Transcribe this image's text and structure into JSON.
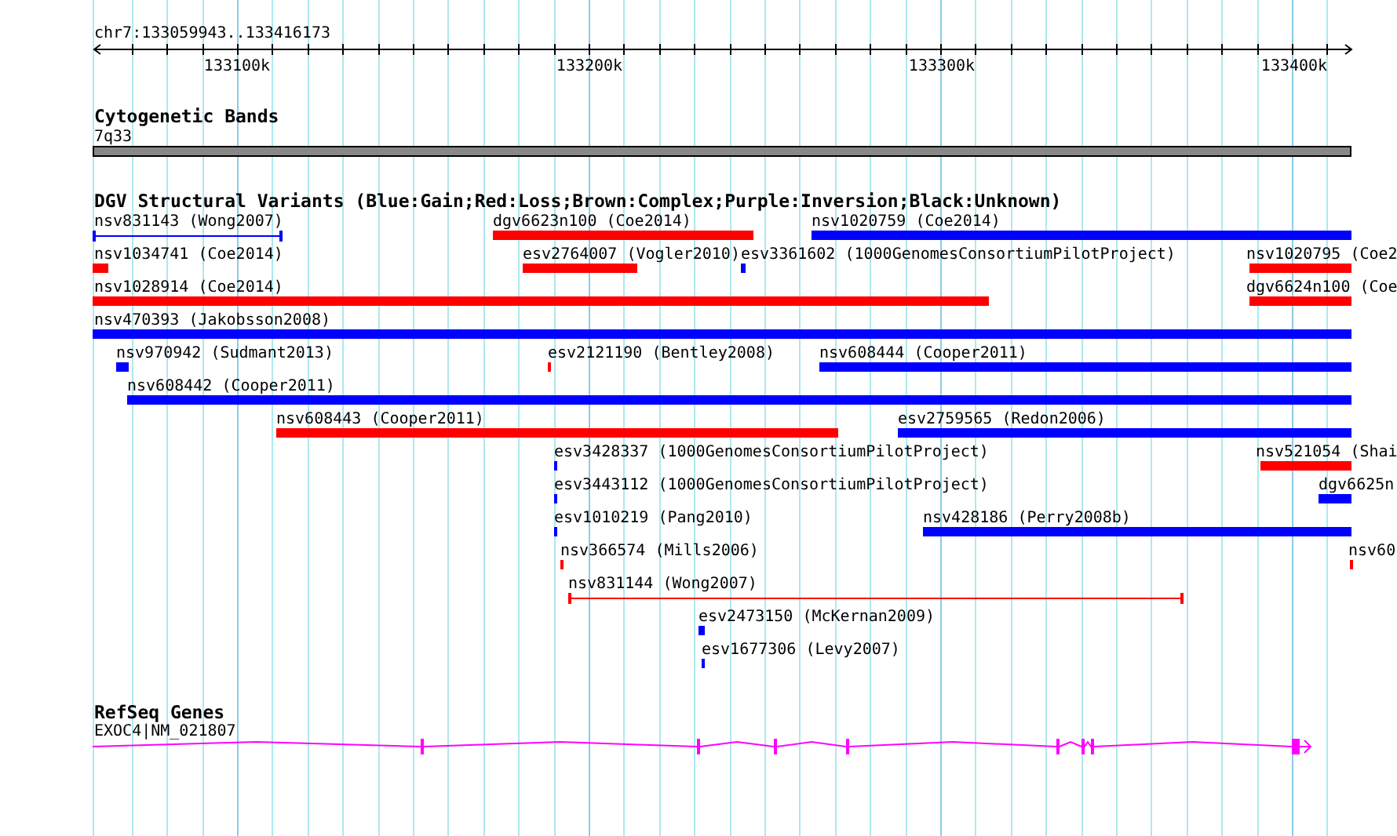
{
  "ruler": {
    "position": "chr7:133059943..133416173",
    "ticks": [
      "133100k",
      "133200k",
      "133300k",
      "133400k"
    ]
  },
  "cytogenetic_bands": {
    "title": "Cytogenetic Bands",
    "band_label": "7q33"
  },
  "dgv_variants": {
    "title": "DGV Structural Variants (Blue:Gain;Red:Loss;Brown:Complex;Purple:Inversion;Black:Unknown)",
    "rows": [
      {
        "features": [
          {
            "label": "nsv831143 (Wong2007)",
            "color": "#0000ff",
            "kind": "line"
          },
          {
            "label": "dgv6623n100 (Coe2014)",
            "color": "#ff0000",
            "kind": "bar"
          },
          {
            "label": "nsv1020759 (Coe2014)",
            "color": "#0000ff",
            "kind": "bar"
          }
        ]
      },
      {
        "features": [
          {
            "label": "nsv1034741 (Coe2014)",
            "color": "#ff0000",
            "kind": "bar"
          },
          {
            "label": "esv2764007 (Vogler2010)",
            "color": "#ff0000",
            "kind": "bar"
          },
          {
            "label": "esv3361602 (1000GenomesConsortiumPilotProject)",
            "color": "#0000ff",
            "kind": "bar"
          },
          {
            "label": "nsv1020795 (Coe2",
            "color": "#ff0000",
            "kind": "bar"
          }
        ]
      },
      {
        "features": [
          {
            "label": "nsv1028914 (Coe2014)",
            "color": "#ff0000",
            "kind": "bar"
          },
          {
            "label": "dgv6624n100 (Coe",
            "color": "#ff0000",
            "kind": "bar"
          }
        ]
      },
      {
        "features": [
          {
            "label": "nsv470393 (Jakobsson2008)",
            "color": "#0000ff",
            "kind": "bar"
          }
        ]
      },
      {
        "features": [
          {
            "label": "nsv970942 (Sudmant2013)",
            "color": "#0000ff",
            "kind": "bar"
          },
          {
            "label": "esv2121190 (Bentley2008)",
            "color": "#ff0000",
            "kind": "bar"
          },
          {
            "label": "nsv608444 (Cooper2011)",
            "color": "#0000ff",
            "kind": "bar"
          }
        ]
      },
      {
        "features": [
          {
            "label": "nsv608442 (Cooper2011)",
            "color": "#0000ff",
            "kind": "bar"
          }
        ]
      },
      {
        "features": [
          {
            "label": "nsv608443 (Cooper2011)",
            "color": "#ff0000",
            "kind": "bar"
          },
          {
            "label": "esv2759565 (Redon2006)",
            "color": "#0000ff",
            "kind": "bar"
          }
        ]
      },
      {
        "features": [
          {
            "label": "esv3428337 (1000GenomesConsortiumPilotProject)",
            "color": "#0000ff",
            "kind": "bar"
          },
          {
            "label": "nsv521054 (Shai",
            "color": "#ff0000",
            "kind": "bar"
          }
        ]
      },
      {
        "features": [
          {
            "label": "esv3443112 (1000GenomesConsortiumPilotProject)",
            "color": "#0000ff",
            "kind": "bar"
          },
          {
            "label": "dgv6625n",
            "color": "#0000ff",
            "kind": "bar"
          }
        ]
      },
      {
        "features": [
          {
            "label": "esv1010219 (Pang2010)",
            "color": "#0000ff",
            "kind": "bar"
          },
          {
            "label": "nsv428186 (Perry2008b)",
            "color": "#0000ff",
            "kind": "bar"
          }
        ]
      },
      {
        "features": [
          {
            "label": "nsv366574 (Mills2006)",
            "color": "#ff0000",
            "kind": "bar"
          },
          {
            "label": "nsv60",
            "color": "#ff0000",
            "kind": "bar"
          }
        ]
      },
      {
        "features": [
          {
            "label": "nsv831144 (Wong2007)",
            "color": "#ff0000",
            "kind": "line"
          }
        ]
      },
      {
        "features": [
          {
            "label": "esv2473150 (McKernan2009)",
            "color": "#0000ff",
            "kind": "bar"
          }
        ]
      },
      {
        "features": [
          {
            "label": "esv1677306 (Levy2007)",
            "color": "#0000ff",
            "kind": "bar"
          }
        ]
      }
    ]
  },
  "refseq_genes": {
    "title": "RefSeq Genes",
    "gene_label": "EXOC4|NM_021807"
  }
}
